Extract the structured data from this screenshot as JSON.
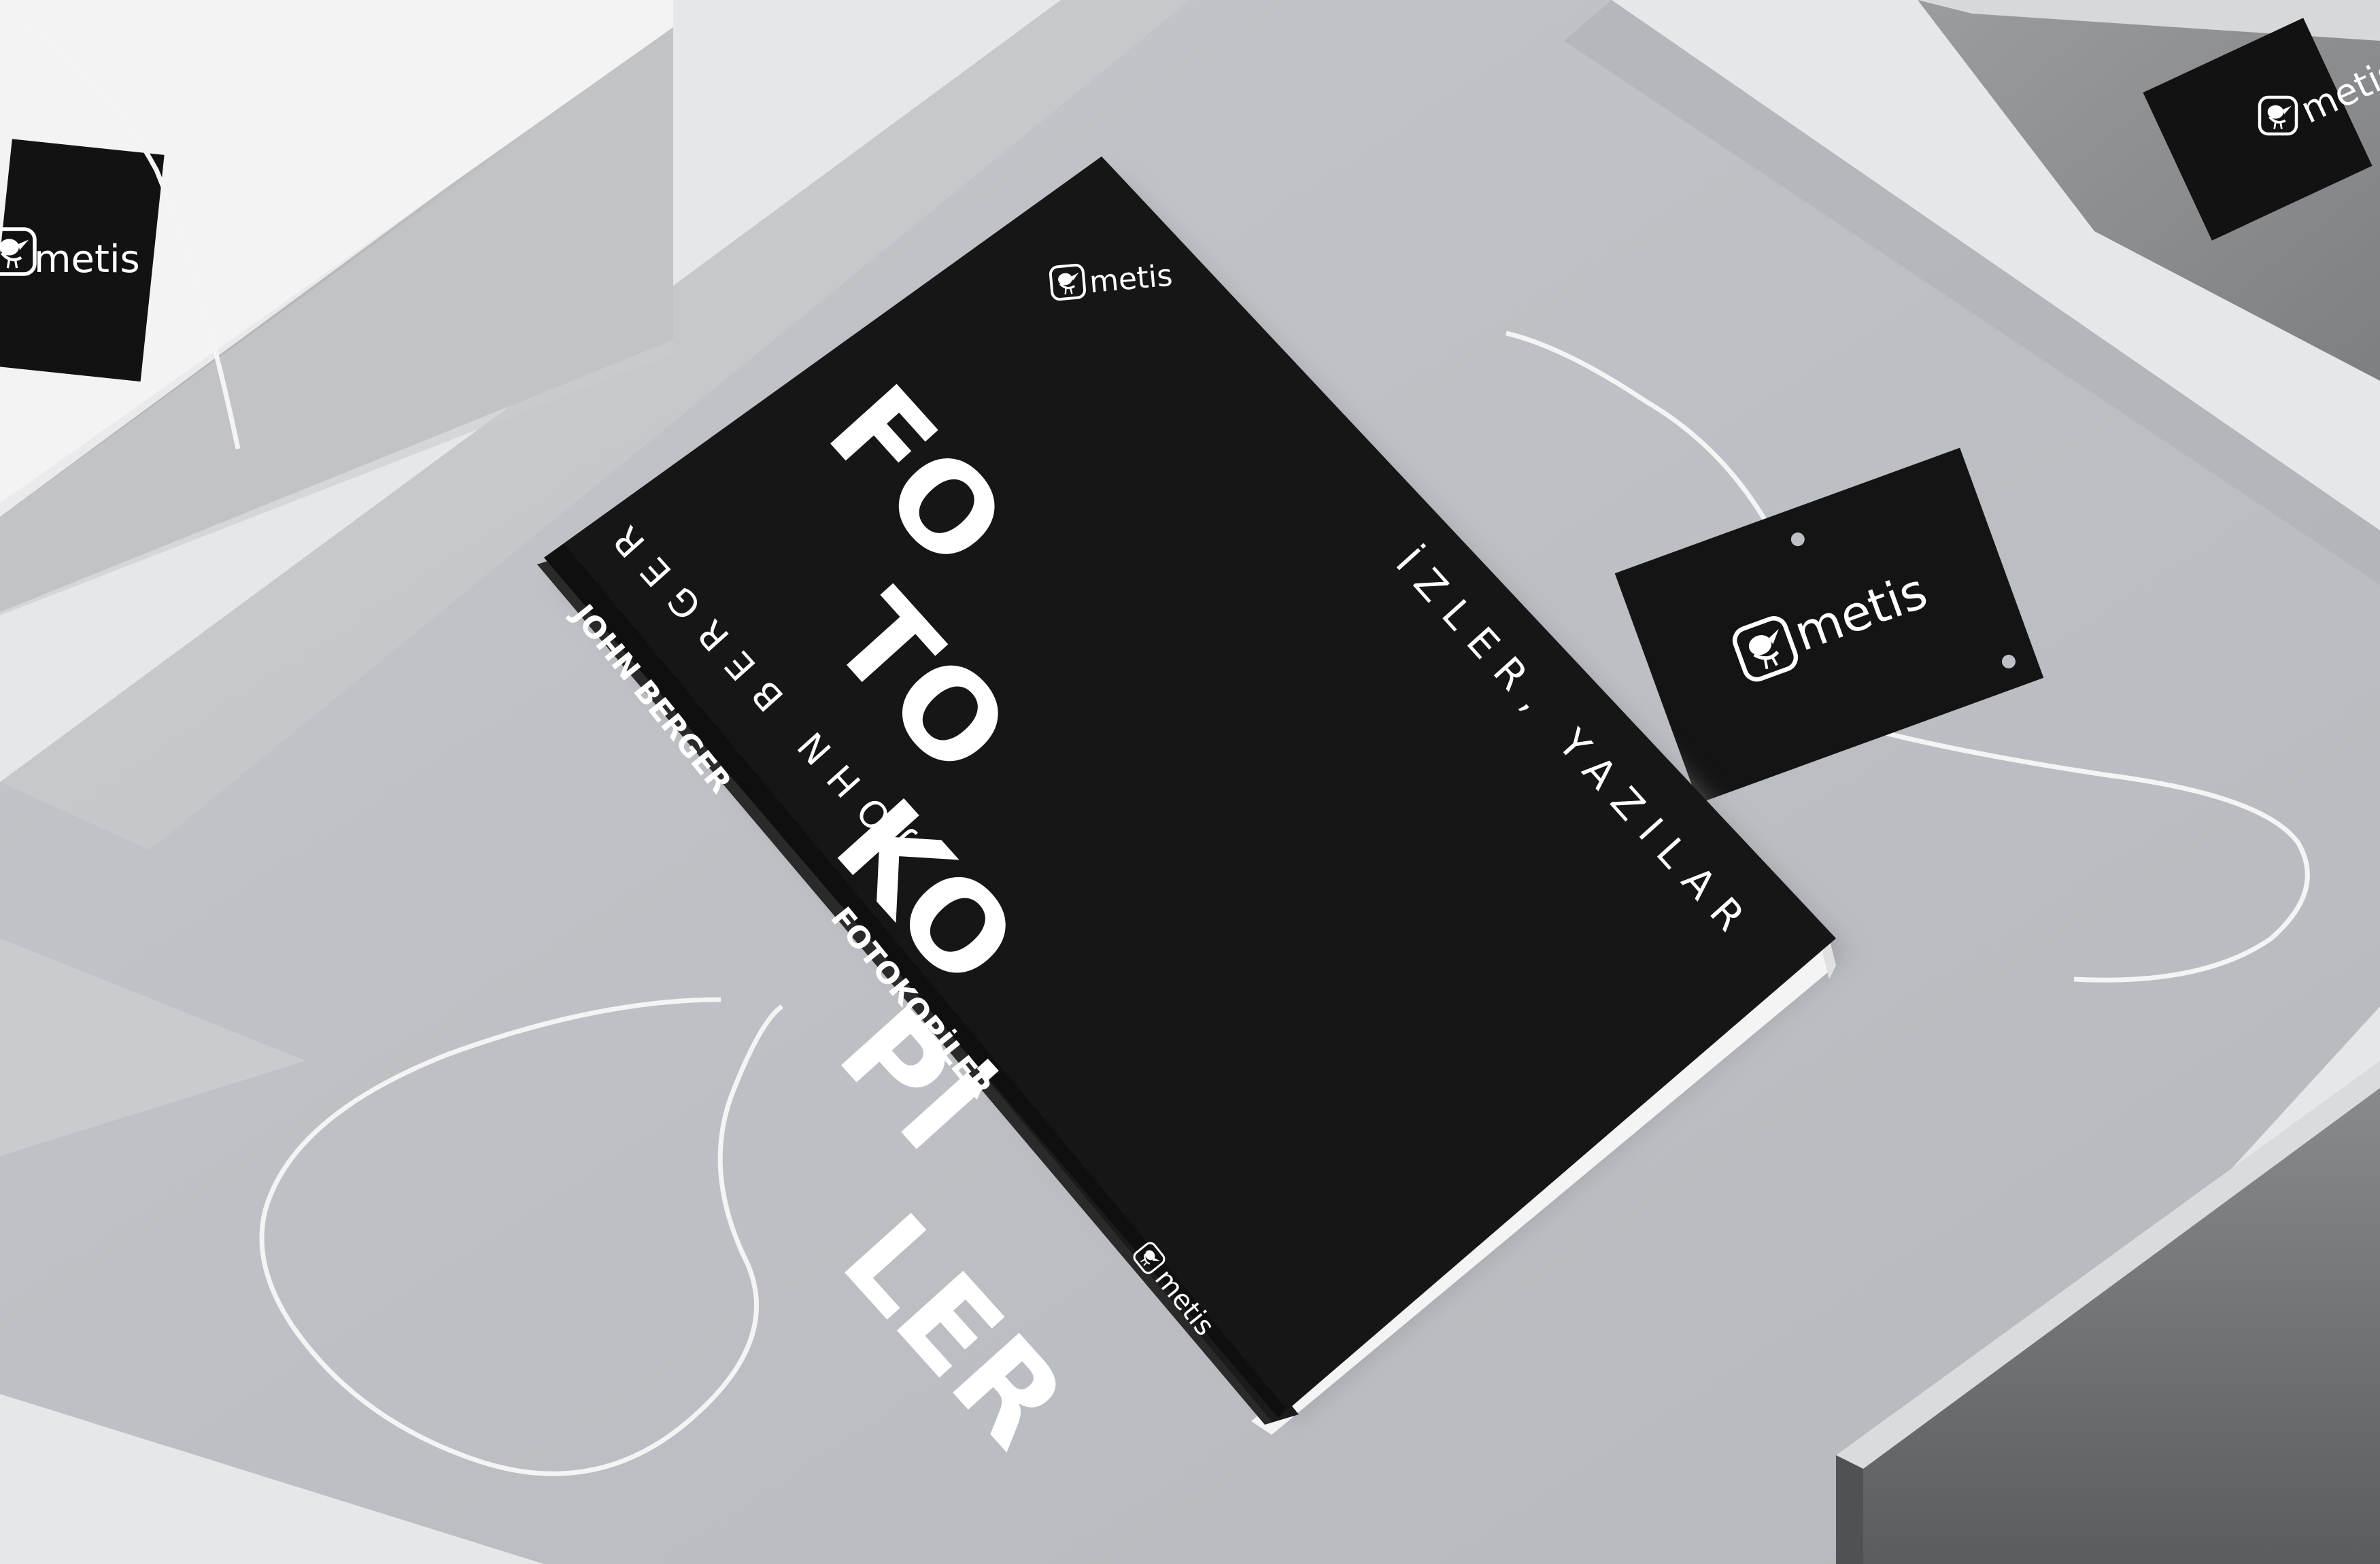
{
  "book": {
    "title_lines": [
      "FO",
      "TO",
      "KO",
      "Pİ",
      "LER"
    ],
    "subtitle": "İZLER, YAZILAR",
    "author_cover": "JOHN BERGER",
    "spine_author": "JOHN BERGER",
    "spine_title": "FOTOKOPİLER",
    "spine_publisher": "metis",
    "cover_publisher": "metis"
  },
  "tags": {
    "hang_tag_brand": "metis",
    "box_left_brand": "metis",
    "box_right_brand": "metis"
  },
  "icons": [
    "bird-logo-icon"
  ],
  "colors": {
    "background": "#e6e7e9",
    "paper": "#bcbfc3",
    "book_black": "#161616",
    "text_white": "#ffffff",
    "string": "#f4f4f4"
  }
}
